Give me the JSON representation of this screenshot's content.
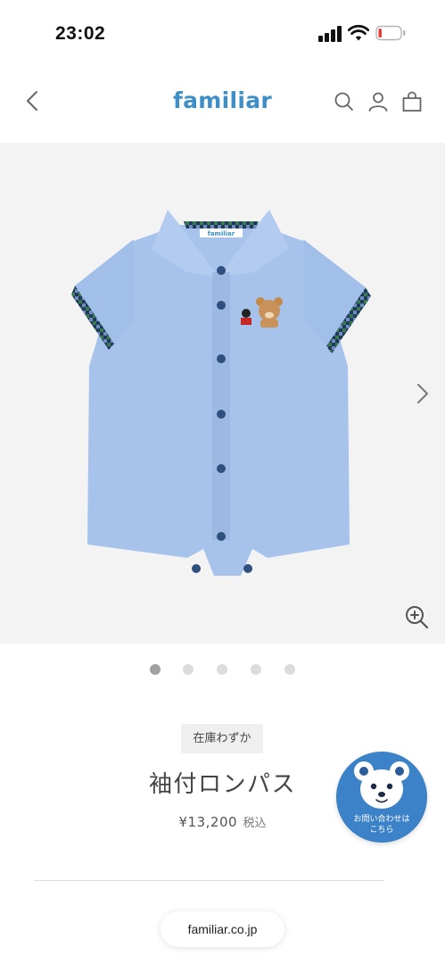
{
  "status_bar": {
    "time": "23:02",
    "signal_icon": "cellular-signal-icon",
    "wifi_icon": "wifi-icon",
    "battery_icon": "battery-low-icon",
    "battery_level": 0.12,
    "battery_color": "#e53935"
  },
  "header": {
    "logo": "familiar",
    "brand_color": "#3e8fc7",
    "back_icon": "chevron-left-icon",
    "search_icon": "search-icon",
    "account_icon": "user-icon",
    "cart_icon": "shopping-bag-icon"
  },
  "gallery": {
    "image_tag": "familiar",
    "next_icon": "chevron-right-icon",
    "zoom_icon": "zoom-in-icon",
    "slide_count": 5,
    "active_slide": 1
  },
  "product": {
    "stock_status": "在庫わずか",
    "name": "袖付ロンパス",
    "price": "¥13,200",
    "tax_label": "税込"
  },
  "contact": {
    "label_line1": "お問い合わせは",
    "label_line2": "こちら",
    "icon": "bear-face-icon",
    "color": "#3c82c8"
  },
  "browser": {
    "url": "familiar.co.jp"
  }
}
